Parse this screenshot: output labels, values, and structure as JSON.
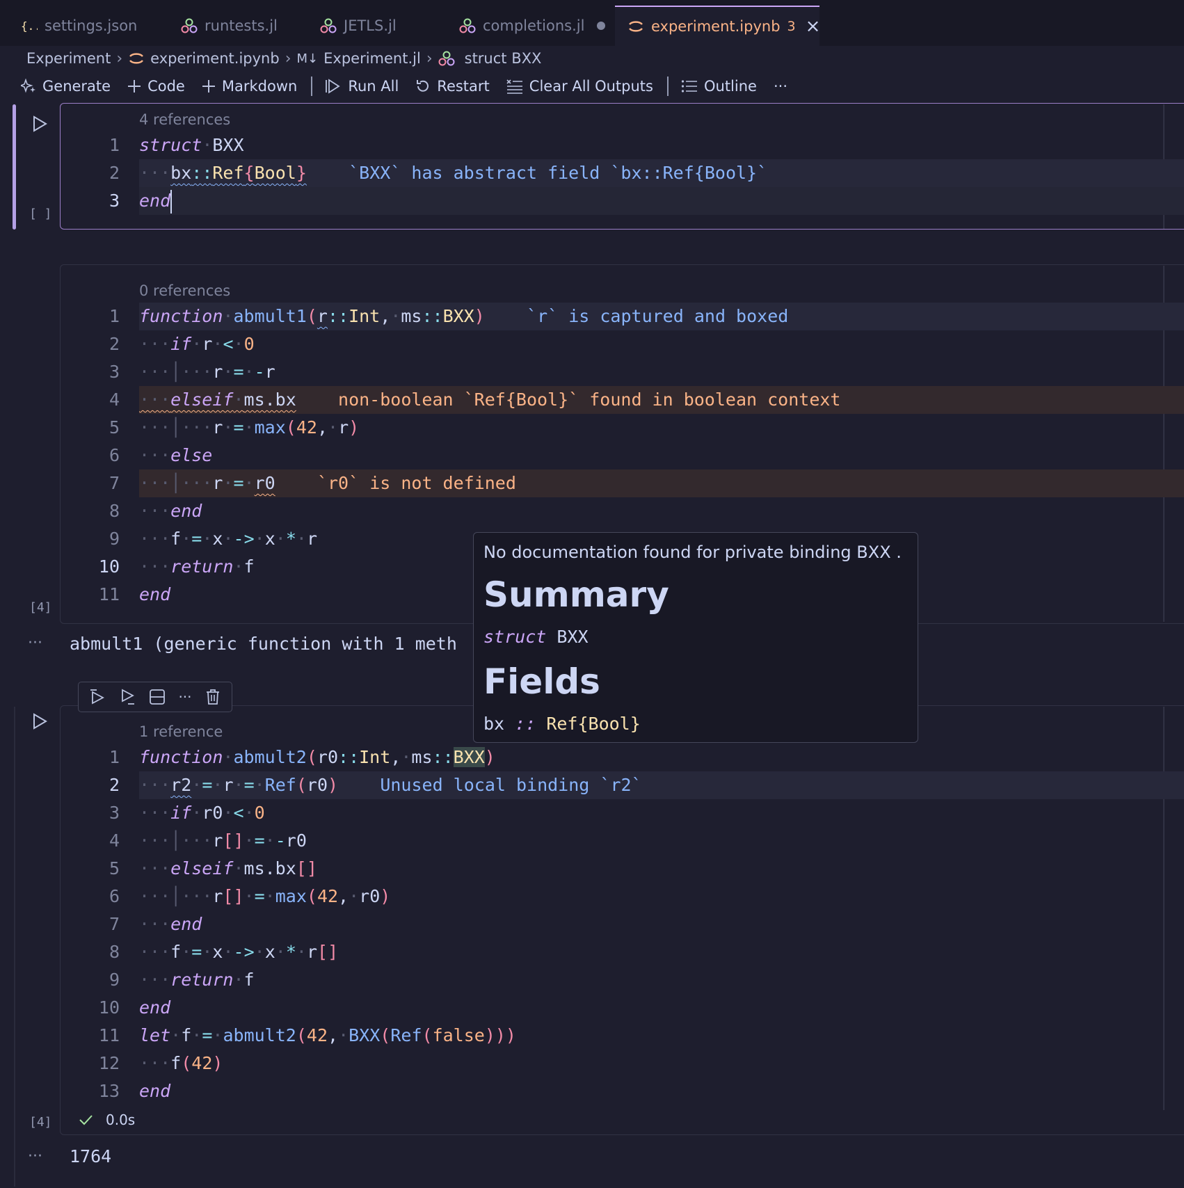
{
  "tabs": [
    {
      "label": "settings.json",
      "icon": "json-braces-icon"
    },
    {
      "label": "runtests.jl",
      "icon": "julia-icon"
    },
    {
      "label": "JETLS.jl",
      "icon": "julia-icon"
    },
    {
      "label": "completions.jl",
      "icon": "julia-icon",
      "modified": true
    },
    {
      "label": "experiment.ipynb",
      "icon": "jupyter-icon",
      "badge": "3",
      "active": true
    }
  ],
  "breadcrumb": {
    "items": [
      "Experiment",
      "experiment.ipynb",
      "Experiment.jl",
      "struct BXX"
    ],
    "prefix_md": "M↓"
  },
  "toolbar": {
    "generate": "Generate",
    "code": "Code",
    "markdown": "Markdown",
    "run_all": "Run All",
    "restart": "Restart",
    "clear_all_outputs": "Clear All Outputs",
    "outline": "Outline",
    "more": "···"
  },
  "cell1": {
    "refs": "4 references",
    "line_numbers": [
      "1",
      "2",
      "3"
    ],
    "exec_count": "[ ]",
    "diagnostic": "`BXX` has abstract field `bx::Ref{Bool}`"
  },
  "cell2": {
    "refs": "0 references",
    "line_numbers": [
      "1",
      "2",
      "3",
      "4",
      "5",
      "6",
      "7",
      "8",
      "9",
      "10",
      "11"
    ],
    "exec_count": "[4]",
    "diag1": "`r` is captured and boxed",
    "diag4": "non-boolean `Ref{Bool}` found in boolean context",
    "diag7": "`r0` is not defined",
    "output": "abmult1 (generic function with 1 meth"
  },
  "cell3": {
    "refs": "1 reference",
    "line_numbers": [
      "1",
      "2",
      "3",
      "4",
      "5",
      "6",
      "7",
      "8",
      "9",
      "10",
      "11",
      "12",
      "13"
    ],
    "exec_count": "[4]",
    "diag2": "Unused local binding `r2`",
    "status_time": "0.0s",
    "output": "1764"
  },
  "hover": {
    "text": "No documentation found for private binding  BXX .",
    "summary_heading": "Summary",
    "fields_heading": "Fields"
  },
  "output_ellipsis": "···",
  "colors": {
    "background": "#1e1e2e",
    "accent": "#cba6f7",
    "active_tab": "#fab387",
    "info": "#89b4fa",
    "warning": "#fab387"
  }
}
